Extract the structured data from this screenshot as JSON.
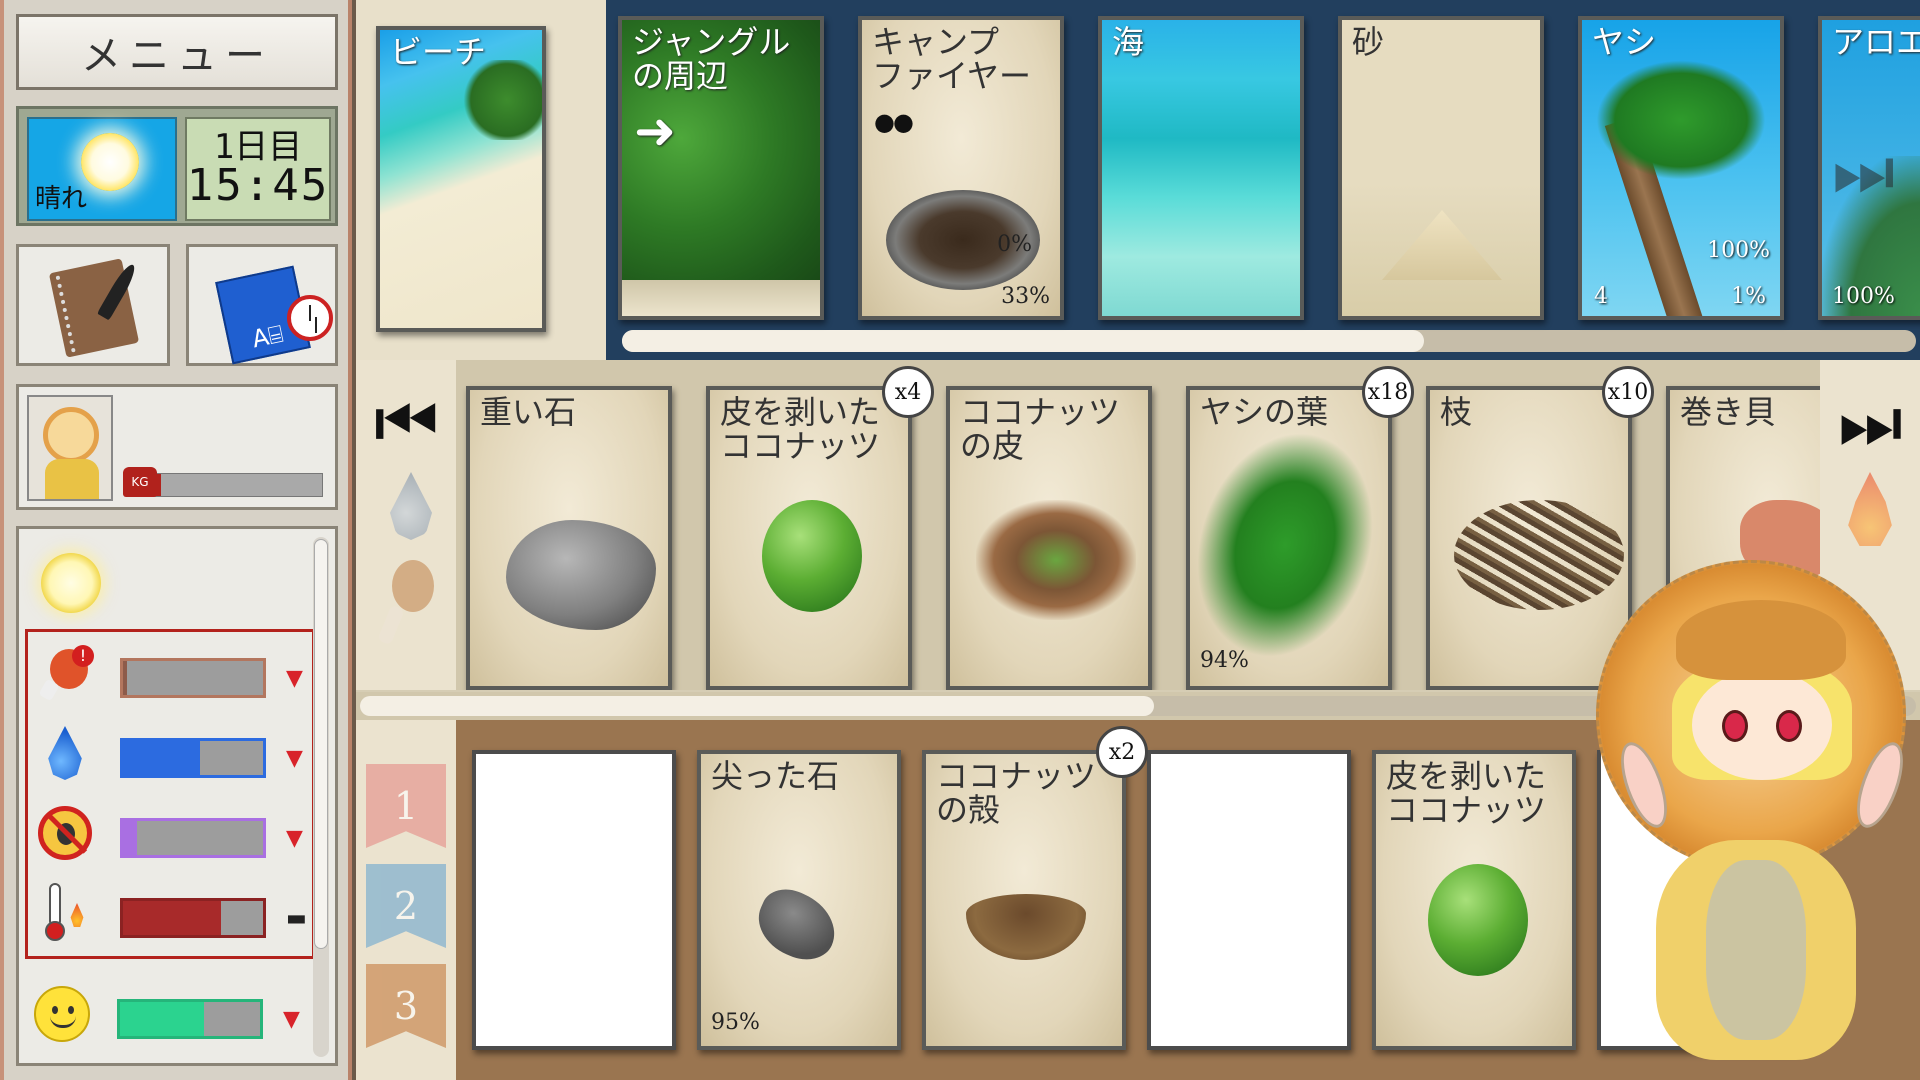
{
  "left_panel": {
    "menu_label": "メニュー",
    "weather": {
      "label": "晴れ",
      "icon": "sun-icon"
    },
    "clock": {
      "day": "1日目",
      "time": "15:45"
    },
    "buttons": {
      "journal_icon": "notebook-quill-icon",
      "craft_icon": "blueprint-alarm-icon"
    },
    "weight": {
      "icon_label": "KG",
      "fraction": 0.05,
      "color": "#b1221c"
    },
    "status": {
      "env_icon": "sun-icon",
      "needs": [
        {
          "name": "hunger",
          "icon": "meat-warning-icon",
          "fraction": 0.03,
          "color": "#8d5b4a",
          "border": "#b3765e",
          "trend": "▼"
        },
        {
          "name": "thirst",
          "icon": "water-drop-icon",
          "fraction": 0.55,
          "color": "#2c6be0",
          "border": "#2c6be0",
          "trend": "▼"
        },
        {
          "name": "pests",
          "icon": "no-bug-icon",
          "fraction": 0.1,
          "color": "#a96fe2",
          "border": "#a96fe2",
          "trend": "▼"
        },
        {
          "name": "temperature",
          "icon": "thermometer-flame-icon",
          "fraction": 0.7,
          "color": "#a82a2a",
          "border": "#8b2222",
          "trend": "▬"
        }
      ],
      "happiness": {
        "icon": "smiley-icon",
        "fraction": 0.6,
        "color": "#2bd38f",
        "border": "#25b57a",
        "trend": "▼"
      }
    }
  },
  "locations": {
    "current": {
      "title": "ビーチ"
    },
    "cards": [
      {
        "title": "ジャングル\nの周辺",
        "art": "jungle"
      },
      {
        "title": "キャンプ\nファイヤー",
        "art": "fire",
        "stat1": "0%",
        "stat2": "33%"
      },
      {
        "title": "海",
        "art": "sea"
      },
      {
        "title": "砂",
        "art": "sand"
      },
      {
        "title": "ヤシ",
        "art": "palm",
        "stat1": "100%",
        "stat2": "1%",
        "stat3": "4"
      },
      {
        "title": "アロエ",
        "art": "aloe",
        "stat1": "100%"
      }
    ],
    "scroll_fraction": 0.62
  },
  "inventory": {
    "items": [
      {
        "title": "重い石",
        "art": "stone"
      },
      {
        "title": "皮を剥いた\nココナッツ",
        "art": "coconut",
        "count": "x4"
      },
      {
        "title": "ココナッツ\nの皮",
        "art": "husk"
      },
      {
        "title": "ヤシの葉",
        "art": "leaf",
        "count": "x18",
        "stat": "94%"
      },
      {
        "title": "枝",
        "art": "sticks",
        "count": "x10"
      },
      {
        "title": "巻き貝",
        "art": "shell"
      }
    ],
    "scroll_fraction": 0.51
  },
  "hand": {
    "hotbar": [
      "1",
      "2",
      "3"
    ],
    "slots": [
      {
        "title": "",
        "empty": true
      },
      {
        "title": "尖った石",
        "art": "sharp-stone",
        "stat": "95%"
      },
      {
        "title": "ココナッツ\nの殻",
        "art": "shell-half",
        "count": "x2"
      },
      {
        "title": "",
        "empty": true
      },
      {
        "title": "皮を剥いた\nココナッツ",
        "art": "coconut"
      },
      {
        "title": "",
        "empty": true
      }
    ]
  },
  "colors": {
    "panel_border": "#b9836a",
    "alert_red": "#b3221c",
    "location_row_bg": "#223f5e"
  }
}
